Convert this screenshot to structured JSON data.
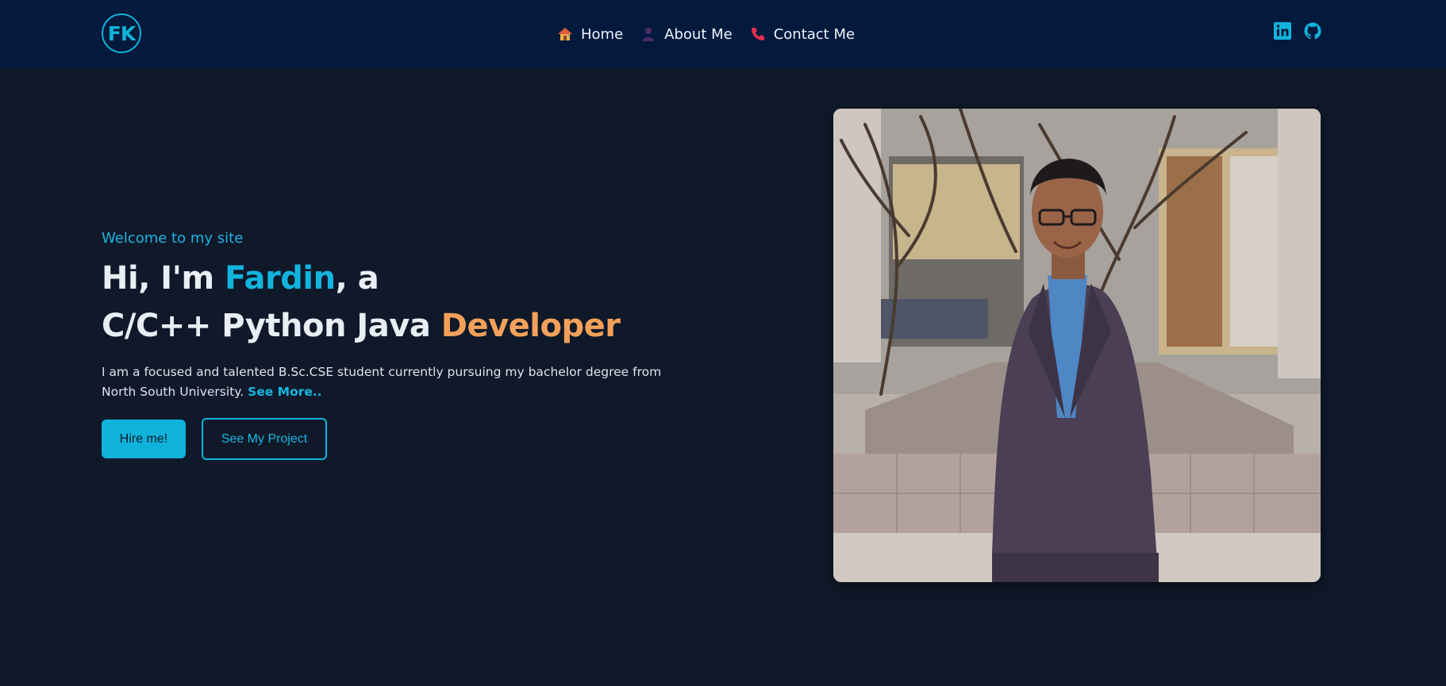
{
  "header": {
    "logo_text": "FK",
    "nav": [
      {
        "label": "Home",
        "icon": "house-icon"
      },
      {
        "label": "About Me",
        "icon": "person-icon"
      },
      {
        "label": "Contact Me",
        "icon": "phone-icon"
      }
    ],
    "social": [
      {
        "icon": "linkedin-icon"
      },
      {
        "icon": "github-icon"
      }
    ]
  },
  "hero": {
    "welcome": "Welcome to my site",
    "title_line1_prefix": "Hi, I'm ",
    "title_name": "Fardin",
    "title_line1_suffix": ", a",
    "title_line2_prefix": "C/C++ Python Java ",
    "title_role": "Developer",
    "description": "I am a focused and talented B.Sc.CSE student currently pursuing my bachelor degree from North South University. ",
    "see_more": "See More..",
    "hire_button": "Hire me!",
    "project_button": "See My Project"
  },
  "colors": {
    "background": "#0f1929",
    "nav_background": "#031a3d",
    "accent": "#0fb3d8",
    "orange": "#f3a15a"
  }
}
